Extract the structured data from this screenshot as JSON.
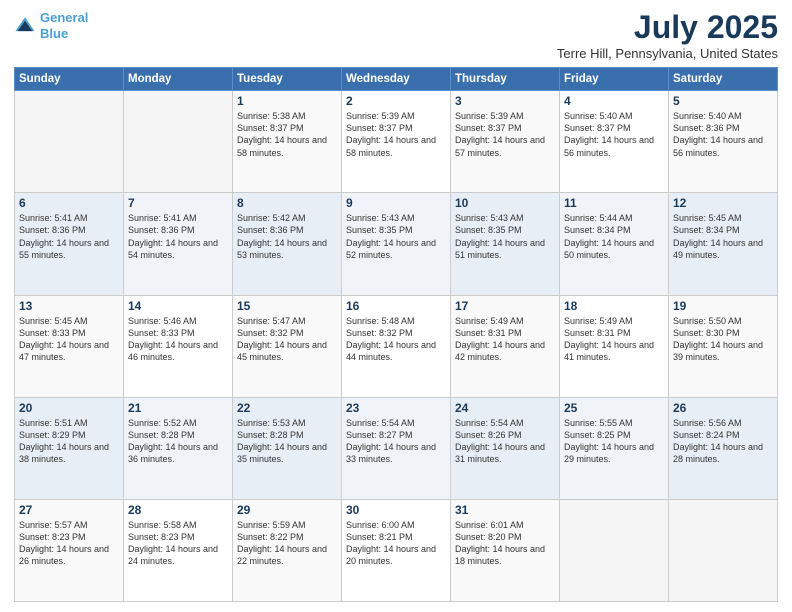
{
  "header": {
    "logo_line1": "General",
    "logo_line2": "Blue",
    "title": "July 2025",
    "subtitle": "Terre Hill, Pennsylvania, United States"
  },
  "days_of_week": [
    "Sunday",
    "Monday",
    "Tuesday",
    "Wednesday",
    "Thursday",
    "Friday",
    "Saturday"
  ],
  "weeks": [
    [
      {
        "day": "",
        "sunrise": "",
        "sunset": "",
        "daylight": ""
      },
      {
        "day": "",
        "sunrise": "",
        "sunset": "",
        "daylight": ""
      },
      {
        "day": "1",
        "sunrise": "Sunrise: 5:38 AM",
        "sunset": "Sunset: 8:37 PM",
        "daylight": "Daylight: 14 hours and 58 minutes."
      },
      {
        "day": "2",
        "sunrise": "Sunrise: 5:39 AM",
        "sunset": "Sunset: 8:37 PM",
        "daylight": "Daylight: 14 hours and 58 minutes."
      },
      {
        "day": "3",
        "sunrise": "Sunrise: 5:39 AM",
        "sunset": "Sunset: 8:37 PM",
        "daylight": "Daylight: 14 hours and 57 minutes."
      },
      {
        "day": "4",
        "sunrise": "Sunrise: 5:40 AM",
        "sunset": "Sunset: 8:37 PM",
        "daylight": "Daylight: 14 hours and 56 minutes."
      },
      {
        "day": "5",
        "sunrise": "Sunrise: 5:40 AM",
        "sunset": "Sunset: 8:36 PM",
        "daylight": "Daylight: 14 hours and 56 minutes."
      }
    ],
    [
      {
        "day": "6",
        "sunrise": "Sunrise: 5:41 AM",
        "sunset": "Sunset: 8:36 PM",
        "daylight": "Daylight: 14 hours and 55 minutes."
      },
      {
        "day": "7",
        "sunrise": "Sunrise: 5:41 AM",
        "sunset": "Sunset: 8:36 PM",
        "daylight": "Daylight: 14 hours and 54 minutes."
      },
      {
        "day": "8",
        "sunrise": "Sunrise: 5:42 AM",
        "sunset": "Sunset: 8:36 PM",
        "daylight": "Daylight: 14 hours and 53 minutes."
      },
      {
        "day": "9",
        "sunrise": "Sunrise: 5:43 AM",
        "sunset": "Sunset: 8:35 PM",
        "daylight": "Daylight: 14 hours and 52 minutes."
      },
      {
        "day": "10",
        "sunrise": "Sunrise: 5:43 AM",
        "sunset": "Sunset: 8:35 PM",
        "daylight": "Daylight: 14 hours and 51 minutes."
      },
      {
        "day": "11",
        "sunrise": "Sunrise: 5:44 AM",
        "sunset": "Sunset: 8:34 PM",
        "daylight": "Daylight: 14 hours and 50 minutes."
      },
      {
        "day": "12",
        "sunrise": "Sunrise: 5:45 AM",
        "sunset": "Sunset: 8:34 PM",
        "daylight": "Daylight: 14 hours and 49 minutes."
      }
    ],
    [
      {
        "day": "13",
        "sunrise": "Sunrise: 5:45 AM",
        "sunset": "Sunset: 8:33 PM",
        "daylight": "Daylight: 14 hours and 47 minutes."
      },
      {
        "day": "14",
        "sunrise": "Sunrise: 5:46 AM",
        "sunset": "Sunset: 8:33 PM",
        "daylight": "Daylight: 14 hours and 46 minutes."
      },
      {
        "day": "15",
        "sunrise": "Sunrise: 5:47 AM",
        "sunset": "Sunset: 8:32 PM",
        "daylight": "Daylight: 14 hours and 45 minutes."
      },
      {
        "day": "16",
        "sunrise": "Sunrise: 5:48 AM",
        "sunset": "Sunset: 8:32 PM",
        "daylight": "Daylight: 14 hours and 44 minutes."
      },
      {
        "day": "17",
        "sunrise": "Sunrise: 5:49 AM",
        "sunset": "Sunset: 8:31 PM",
        "daylight": "Daylight: 14 hours and 42 minutes."
      },
      {
        "day": "18",
        "sunrise": "Sunrise: 5:49 AM",
        "sunset": "Sunset: 8:31 PM",
        "daylight": "Daylight: 14 hours and 41 minutes."
      },
      {
        "day": "19",
        "sunrise": "Sunrise: 5:50 AM",
        "sunset": "Sunset: 8:30 PM",
        "daylight": "Daylight: 14 hours and 39 minutes."
      }
    ],
    [
      {
        "day": "20",
        "sunrise": "Sunrise: 5:51 AM",
        "sunset": "Sunset: 8:29 PM",
        "daylight": "Daylight: 14 hours and 38 minutes."
      },
      {
        "day": "21",
        "sunrise": "Sunrise: 5:52 AM",
        "sunset": "Sunset: 8:28 PM",
        "daylight": "Daylight: 14 hours and 36 minutes."
      },
      {
        "day": "22",
        "sunrise": "Sunrise: 5:53 AM",
        "sunset": "Sunset: 8:28 PM",
        "daylight": "Daylight: 14 hours and 35 minutes."
      },
      {
        "day": "23",
        "sunrise": "Sunrise: 5:54 AM",
        "sunset": "Sunset: 8:27 PM",
        "daylight": "Daylight: 14 hours and 33 minutes."
      },
      {
        "day": "24",
        "sunrise": "Sunrise: 5:54 AM",
        "sunset": "Sunset: 8:26 PM",
        "daylight": "Daylight: 14 hours and 31 minutes."
      },
      {
        "day": "25",
        "sunrise": "Sunrise: 5:55 AM",
        "sunset": "Sunset: 8:25 PM",
        "daylight": "Daylight: 14 hours and 29 minutes."
      },
      {
        "day": "26",
        "sunrise": "Sunrise: 5:56 AM",
        "sunset": "Sunset: 8:24 PM",
        "daylight": "Daylight: 14 hours and 28 minutes."
      }
    ],
    [
      {
        "day": "27",
        "sunrise": "Sunrise: 5:57 AM",
        "sunset": "Sunset: 8:23 PM",
        "daylight": "Daylight: 14 hours and 26 minutes."
      },
      {
        "day": "28",
        "sunrise": "Sunrise: 5:58 AM",
        "sunset": "Sunset: 8:23 PM",
        "daylight": "Daylight: 14 hours and 24 minutes."
      },
      {
        "day": "29",
        "sunrise": "Sunrise: 5:59 AM",
        "sunset": "Sunset: 8:22 PM",
        "daylight": "Daylight: 14 hours and 22 minutes."
      },
      {
        "day": "30",
        "sunrise": "Sunrise: 6:00 AM",
        "sunset": "Sunset: 8:21 PM",
        "daylight": "Daylight: 14 hours and 20 minutes."
      },
      {
        "day": "31",
        "sunrise": "Sunrise: 6:01 AM",
        "sunset": "Sunset: 8:20 PM",
        "daylight": "Daylight: 14 hours and 18 minutes."
      },
      {
        "day": "",
        "sunrise": "",
        "sunset": "",
        "daylight": ""
      },
      {
        "day": "",
        "sunrise": "",
        "sunset": "",
        "daylight": ""
      }
    ]
  ]
}
